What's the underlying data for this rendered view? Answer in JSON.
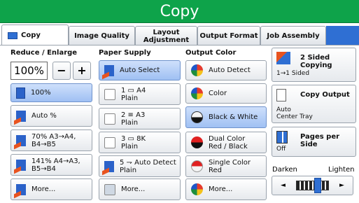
{
  "window": {
    "title": "Copy"
  },
  "tabs": [
    {
      "label": "Copy",
      "active": true
    },
    {
      "label": "Image Quality"
    },
    {
      "label": "Layout\nAdjustment"
    },
    {
      "label": "Output Format"
    },
    {
      "label": "Job Assembly"
    }
  ],
  "reduce_enlarge": {
    "heading": "Reduce / Enlarge",
    "zoom_value": "100%",
    "minus": "−",
    "plus": "+",
    "options": [
      "100%",
      "Auto %",
      "70% A3→A4,\nB4→B5",
      "141% A4→A3,\nB5→B4",
      "More..."
    ],
    "selected_index": 0
  },
  "paper_supply": {
    "heading": "Paper Supply",
    "options": [
      "Auto Select",
      "1 ▭ A4\nPlain",
      "2 ≡ A3\nPlain",
      "3 ▭ 8K\nPlain",
      "5 ⇁ Auto Detect\nPlain",
      "More..."
    ],
    "selected_index": 0
  },
  "output_color": {
    "heading": "Output Color",
    "options": [
      "Auto Detect",
      "Color",
      "Black & White",
      "Dual Color\nRed / Black",
      "Single Color\nRed",
      "More..."
    ],
    "selected_index": 2
  },
  "right": {
    "two_sided": {
      "title": "2 Sided Copying",
      "value": "1→1 Sided"
    },
    "copy_output": {
      "title": "Copy Output",
      "value": "Auto\nCenter Tray"
    },
    "pages_per_side": {
      "title": "Pages per Side",
      "value": "Off"
    },
    "darkness": {
      "left_label": "Darken",
      "right_label": "Lighten",
      "left_arrow": "◄",
      "right_arrow": "►"
    }
  },
  "colors": {
    "title_bar": "#0ea34a",
    "selected": "#9fc0f3",
    "accent": "#2f6fd3"
  }
}
